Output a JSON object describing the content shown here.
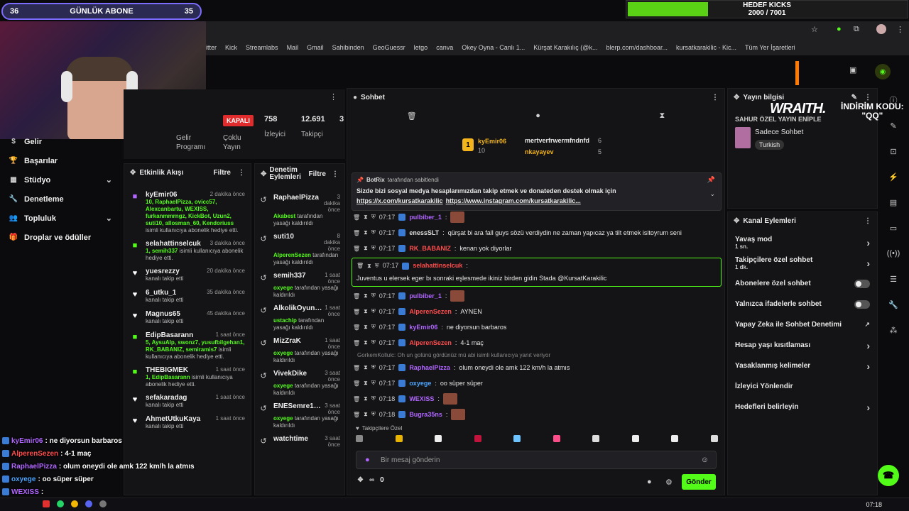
{
  "overlay": {
    "sub_left": "36",
    "sub_title": "GÜNLÜK ABONE",
    "sub_right": "35",
    "goal_title": "HEDEF KICKS",
    "goal_count": "2000 / 7001",
    "goal_progress": 0.2857,
    "sponsor_brand": "WRAITH.",
    "sponsor_code_1": "İNDİRİM KODU:",
    "sponsor_code_2": "\"QQ\""
  },
  "bookmarks": [
    "itter",
    "Kick",
    "Streamlabs",
    "Mail",
    "Gmail",
    "Sahibinden",
    "GeoGuessr",
    "letgo",
    "canva",
    "Okey Oyna - Canlı 1...",
    "Kürşat Karakılıç (@k...",
    "blerp.com/dashboar...",
    "kursatkarakilic - Kic...",
    "Tüm Yer İşaretleri"
  ],
  "nav": {
    "items": [
      {
        "label": "Gelir",
        "icon": "income-icon"
      },
      {
        "label": "Başarılar",
        "icon": "trophy-icon"
      },
      {
        "label": "Stüdyo",
        "icon": "studio-icon",
        "chevron": true
      },
      {
        "label": "Denetleme",
        "icon": "wrench-icon"
      },
      {
        "label": "Topluluk",
        "icon": "community-icon",
        "chevron": true
      },
      {
        "label": "Droplar ve ödüller",
        "icon": "gift-icon"
      }
    ]
  },
  "stats": {
    "program_label_1": "Gelir",
    "program_label_2": "Programı",
    "status": "KAPALI",
    "multi_1": "Çoklu",
    "multi_2": "Yayın",
    "viewers": "758",
    "viewers_label": "İzleyici",
    "followers": "12.691",
    "followers_label": "Takipçi",
    "extra": "3"
  },
  "activity": {
    "title": "Etkinlik Akışı",
    "filter": "Filtre",
    "items": [
      {
        "icon": "gift-sub-icon",
        "color": "#b066ff",
        "name": "kyEmir06",
        "time": "2 dakika önce",
        "hl": "10, RaphaelPizza, ovicc57, Alexcanbartu, WEXISS, furkanmmrngz, KickBot, Uzun2, suti10, allosman_60, Kendoriuss",
        "desc": "isimli kullanıcıya abonelik hediye etti."
      },
      {
        "icon": "gift-sub-icon",
        "color": "#53fc18",
        "name": "selahattinselcuk",
        "time": "3 dakika önce",
        "hl": "1, semih337",
        "desc": "isimli kullanıcıya abonelik hediye etti."
      },
      {
        "icon": "heart-icon",
        "color": "#ffffff",
        "name": "yuesrezzy",
        "time": "20 dakika önce",
        "hl": "",
        "desc": "kanalı takip etti"
      },
      {
        "icon": "heart-icon",
        "color": "#ffffff",
        "name": "6_utku_1",
        "time": "35 dakika önce",
        "hl": "",
        "desc": "kanalı takip etti"
      },
      {
        "icon": "heart-icon",
        "color": "#ffffff",
        "name": "Magnus65",
        "time": "45 dakika önce",
        "hl": "",
        "desc": "kanalı takip etti"
      },
      {
        "icon": "gift-sub-icon",
        "color": "#53fc18",
        "name": "EdipBasarann",
        "time": "1 saat önce",
        "hl": "5, AysuAlp, swonz7, yusufbilgehan1, RK_BABANIZ, semiramis7",
        "desc": "isimli kullanıcıya abonelik hediye etti."
      },
      {
        "icon": "gift-sub-icon",
        "color": "#53fc18",
        "name": "THEBIGMEK",
        "time": "1 saat önce",
        "hl": "1, EdipBasarann",
        "desc": "isimli kullanıcıya abonelik hediye etti."
      },
      {
        "icon": "heart-icon",
        "color": "#ffffff",
        "name": "sefakaradag",
        "time": "1 saat önce",
        "hl": "",
        "desc": "kanalı takip etti"
      },
      {
        "icon": "heart-icon",
        "color": "#ffffff",
        "name": "AhmetUtkuKaya",
        "time": "1 saat önce",
        "hl": "",
        "desc": "kanalı takip etti"
      }
    ]
  },
  "moderation": {
    "title_1": "Denetim",
    "title_2": "Eylemleri",
    "filter": "Filtre",
    "items": [
      {
        "name": "RaphaelPizza",
        "time": "3 dakika önce",
        "mod": "Akabest",
        "desc": "tarafından yasağı kaldırıldı"
      },
      {
        "name": "suti10",
        "time": "8 dakika önce",
        "mod": "AlperenSezen",
        "desc": "tarafından yasağı kaldırıldı"
      },
      {
        "name": "semih337",
        "time": "1 saat önce",
        "mod": "oxyege",
        "desc": "tarafından yasağı kaldırıldı"
      },
      {
        "name": "AlkolikOyuncu",
        "time": "1 saat önce",
        "mod": "ustachip",
        "desc": "tarafından yasağı kaldırıldı"
      },
      {
        "name": "MizZraK",
        "time": "1 saat önce",
        "mod": "oxyege",
        "desc": "tarafından yasağı kaldırıldı"
      },
      {
        "name": "VivekDike",
        "time": "3 saat önce",
        "mod": "oxyege",
        "desc": "tarafından yasağı kaldırıldı"
      },
      {
        "name": "ENESemre1234",
        "time": "3 saat önce",
        "mod": "oxyege",
        "desc": "tarafından yasağı kaldırıldı"
      },
      {
        "name": "watchtime",
        "time": "3 saat önce",
        "mod": "",
        "desc": ""
      }
    ]
  },
  "chat": {
    "title": "Sohbet",
    "leaders": {
      "first_rank": "1",
      "first_name": "kyEmir06",
      "first_count": "10",
      "second_name": "mertverfrwermfndnfd",
      "second_count": "6",
      "third_name": "nkayayev",
      "third_count": "5"
    },
    "pinned": {
      "by": "BotRix",
      "by_suffix": "tarafından sabitlendi",
      "text": "Sizde bizi sosyal medya hesaplarımızdan takip etmek ve donateden destek olmak için",
      "link1": "https://x.com/kursatkarakilic",
      "link2": "https://www.instagram.com/kursatkarakilic..."
    },
    "messages": [
      {
        "time": "07:17",
        "user": "pulbiber_1",
        "color": "#b066ff",
        "text": "",
        "emote": true
      },
      {
        "time": "07:17",
        "user": "enessSLT",
        "color": "#dddddd",
        "text": "qürşat bi ara fall guys sözü verdiydin ne zaman yapıcaz ya tilt etmek isitoyrum seni",
        "emote": false
      },
      {
        "time": "07:17",
        "user": "RK_BABANIZ",
        "color": "#ff4d4d",
        "text": "kenan yok diyorlar",
        "emote": false
      },
      {
        "time": "07:17",
        "user": "selahattinselcuk",
        "color": "#ff4d4d",
        "text": "Juventus u elersek eger bı sonraki eşlesmede ikiniz birden gidin Stada @KursatKarakilic",
        "emote": false,
        "highlight": true
      },
      {
        "time": "07:17",
        "user": "pulbiber_1",
        "color": "#b066ff",
        "text": "",
        "emote": true
      },
      {
        "time": "07:17",
        "user": "AlperenSezen",
        "color": "#ff4d4d",
        "text": "AYNEN",
        "emote": false
      },
      {
        "time": "07:17",
        "user": "kyEmir06",
        "color": "#b066ff",
        "text": "ne diyorsun barbaros",
        "emote": false
      },
      {
        "time": "07:17",
        "user": "AlperenSezen",
        "color": "#ff4d4d",
        "text": "4-1 maç",
        "emote": false
      },
      {
        "time": "07:17",
        "user": "RaphaelPizza",
        "color": "#b066ff",
        "text": "olum oneydi ole amk 122 km/h la atmıs",
        "emote": false,
        "reply": "GorkemKollulc: Oh un golünü gördünüz mü abi isimli kullanıcıya yanıt veriyor"
      },
      {
        "time": "07:17",
        "user": "oxyege",
        "color": "#4da6ff",
        "text": "oo süper süper",
        "emote": false
      },
      {
        "time": "07:18",
        "user": "WEXISS",
        "color": "#b066ff",
        "text": "",
        "emote": true
      },
      {
        "time": "07:18",
        "user": "Bugra35ns",
        "color": "#b066ff",
        "text": "",
        "emote": true
      }
    ],
    "followers_only": "Takipçilere Özel",
    "input_placeholder": "Bir mesaj gönderin",
    "points": "0",
    "send": "Gönder"
  },
  "stream_info": {
    "title": "Yayın bilgisi",
    "stream_title": "SAHUR ÖZEL YAYIN ENİPLE",
    "category": "Sadece Sohbet",
    "language": "Turkish"
  },
  "channel_actions": {
    "title": "Kanal Eylemleri",
    "items": [
      {
        "label": "Yavaş mod",
        "sub": "1 sn.",
        "type": "chevron"
      },
      {
        "label": "Takipçilere özel sohbet",
        "sub": "1 dk.",
        "type": "chevron"
      },
      {
        "label": "Abonelere özel sohbet",
        "sub": "",
        "type": "toggle"
      },
      {
        "label": "Yalnızca ifadelerle sohbet",
        "sub": "",
        "type": "toggle"
      },
      {
        "label": "Yapay Zeka ile Sohbet Denetimi",
        "sub": "",
        "type": "external"
      },
      {
        "label": "Hesap yaşı kısıtlaması",
        "sub": "",
        "type": "chevron"
      },
      {
        "label": "Yasaklanmış kelimeler",
        "sub": "",
        "type": "chevron"
      },
      {
        "label": "İzleyici Yönlendir",
        "sub": "",
        "type": "none"
      },
      {
        "label": "Hedefleri belirleyin",
        "sub": "",
        "type": "chevron"
      }
    ]
  },
  "overlay_chat": [
    {
      "user": "kyEmir06",
      "color": "#b066ff",
      "text": ": ne diyorsun barbaros"
    },
    {
      "user": "AlperenSezen",
      "color": "#ff4d4d",
      "text": ": 4-1 maç"
    },
    {
      "user": "RaphaelPizza",
      "color": "#b066ff",
      "text": ": olum oneydi ole amk 122 km/h la atmıs"
    },
    {
      "user": "oxyege",
      "color": "#4da6ff",
      "text": ": oo süper süper"
    },
    {
      "user": "WEXISS",
      "color": "#b066ff",
      "text": ":"
    },
    {
      "user": "Bugra35ns",
      "color": "#b066ff",
      "text": ""
    }
  ],
  "taskbar": {
    "clock": "07:18"
  }
}
